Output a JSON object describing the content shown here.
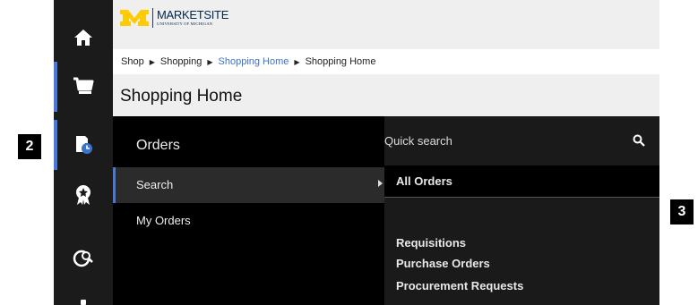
{
  "brand": {
    "title": "MARKETSITE",
    "subtitle": "UNIVERSITY OF MICHIGAN"
  },
  "breadcrumb": [
    "Shop",
    "Shopping",
    "Shopping Home",
    "Shopping Home"
  ],
  "page_title": "Shopping Home",
  "orders_menu": {
    "title": "Orders",
    "items": [
      {
        "label": "Search",
        "active": true
      },
      {
        "label": "My Orders",
        "active": false
      }
    ]
  },
  "submenu": {
    "quick_search": "Quick search",
    "items": [
      {
        "label": "All Orders",
        "active": true
      },
      {
        "label": "Requisitions"
      },
      {
        "label": "Purchase Orders"
      },
      {
        "label": "Procurement Requests"
      }
    ]
  },
  "callouts": {
    "left": "2",
    "right": "3"
  },
  "sidebar": [
    "home-icon",
    "cart-icon",
    "orders-clock-icon",
    "award-ribbon-icon",
    "global-search-icon"
  ],
  "colors": {
    "accent": "#4a78d6",
    "link": "#3b73c9",
    "maize": "#ffcb05",
    "navy": "#00274c"
  }
}
